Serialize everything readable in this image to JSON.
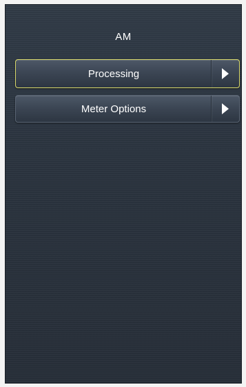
{
  "header": {
    "title": "AM"
  },
  "menu": {
    "items": [
      {
        "label": "Processing",
        "icon": "chevron-right-icon",
        "selected": true
      },
      {
        "label": "Meter Options",
        "icon": "chevron-right-icon",
        "selected": false
      }
    ]
  },
  "colors": {
    "background": "#2b3440",
    "selected_border": "#d9d96a",
    "text": "#ffffff"
  }
}
